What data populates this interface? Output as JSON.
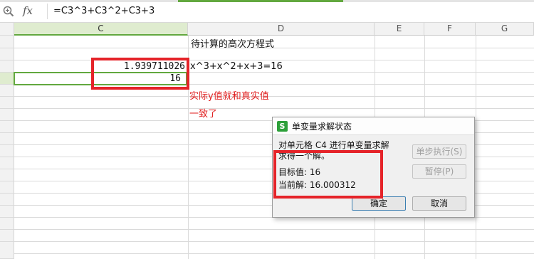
{
  "formula_bar": {
    "fx_label": "fx",
    "formula": "=C3^3+C3^2+C3+3"
  },
  "columns": [
    {
      "name": "C",
      "active": true
    },
    {
      "name": "D",
      "active": false
    },
    {
      "name": "E",
      "active": false
    },
    {
      "name": "F",
      "active": false
    },
    {
      "name": "G",
      "active": false
    }
  ],
  "cells": {
    "D1": "待计算的高次方程式",
    "C3": "1.939711026",
    "D3": "x^3+x^2+x+3=16",
    "C4": "16"
  },
  "annotation": {
    "line1": "实际y值就和真实值",
    "line2": "一致了"
  },
  "dialog": {
    "icon_letter": "S",
    "title": "单变量求解状态",
    "description_line1": "对单元格 C4 进行单变量求解",
    "description_line2": "求得一个解。",
    "target_label": "目标值: 16",
    "current_label": "当前解: 16.000312",
    "step_button": "单步执行(S)",
    "pause_button": "暂停(P)",
    "ok_button": "确定",
    "cancel_button": "取消"
  },
  "colors": {
    "accent_green": "#62a83f",
    "highlight_red": "#e52329",
    "annotation_red": "#e02020"
  }
}
